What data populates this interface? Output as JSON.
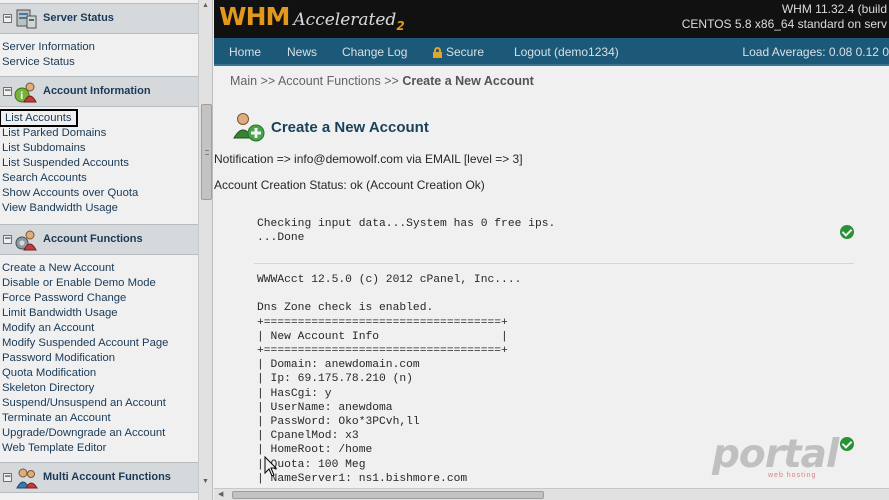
{
  "sidebar": {
    "sections": [
      {
        "title": "Server Status",
        "toggle": "−",
        "icon": "server-icon",
        "links": [
          "Server Information",
          "Service Status"
        ]
      },
      {
        "title": "Account Information",
        "toggle": "−",
        "icon": "account-info-icon",
        "links": [
          "List Accounts",
          "List Parked Domains",
          "List Subdomains",
          "List Suspended Accounts",
          "Search Accounts",
          "Show Accounts over Quota",
          "View Bandwidth Usage"
        ],
        "selected": "List Accounts"
      },
      {
        "title": "Account Functions",
        "toggle": "−",
        "icon": "account-functions-icon",
        "links": [
          "Create a New Account",
          "Disable or Enable Demo Mode",
          "Force Password Change",
          "Limit Bandwidth Usage",
          "Modify an Account",
          "Modify Suspended Account Page",
          "Password Modification",
          "Quota Modification",
          "Skeleton Directory",
          "Suspend/Unsuspend an Account",
          "Terminate an Account",
          "Upgrade/Downgrade an Account",
          "Web Template Editor"
        ]
      },
      {
        "title": "Multi Account Functions",
        "toggle": "−",
        "icon": "multi-account-icon",
        "links": []
      }
    ]
  },
  "header": {
    "logo_main": "WHM",
    "logo_sub": "Accelerated",
    "logo_version": "2",
    "info_line1": "WHM 11.32.4 (build",
    "info_line2": "CENTOS 5.8 x86_64 standard on serv"
  },
  "nav": {
    "items": [
      "Home",
      "News",
      "Change Log",
      "Secure",
      "Logout (demo1234)"
    ],
    "load_avg": "Load Averages: 0.08 0.12 0"
  },
  "breadcrumb": {
    "path": "Main >> Account Functions >> ",
    "current": "Create a New Account"
  },
  "page": {
    "title": "Create a New Account",
    "notification": "Notification => info@demowolf.com via EMAIL [level => 3]",
    "status": "Account Creation Status: ok (Account Creation Ok)",
    "check_block": "Checking input data...System has 0 free ips.\n...Done",
    "output_block": "WWWAcct 12.5.0 (c) 2012 cPanel, Inc....\n\nDns Zone check is enabled.\n+===================================+\n| New Account Info                  |\n+===================================+\n| Domain: anewdomain.com\n| Ip: 69.175.78.210 (n)\n| HasCgi: y\n| UserName: anewdoma\n| PassWord: Oko*3PCvh,ll\n| CpanelMod: x3\n| HomeRoot: /home\n| Quota: 100 Meg\n| NameServer1: ns1.bishmore.com"
  },
  "watermark": {
    "text": "portal",
    "sub": "web hosting"
  },
  "colors": {
    "header_bg": "#131313",
    "nav_bg": "#1e5f80",
    "logo_orange": "#f0a21e",
    "title_blue": "#1b4760",
    "link_blue": "#1c3e5d",
    "check_green": "#2c9c3a"
  }
}
